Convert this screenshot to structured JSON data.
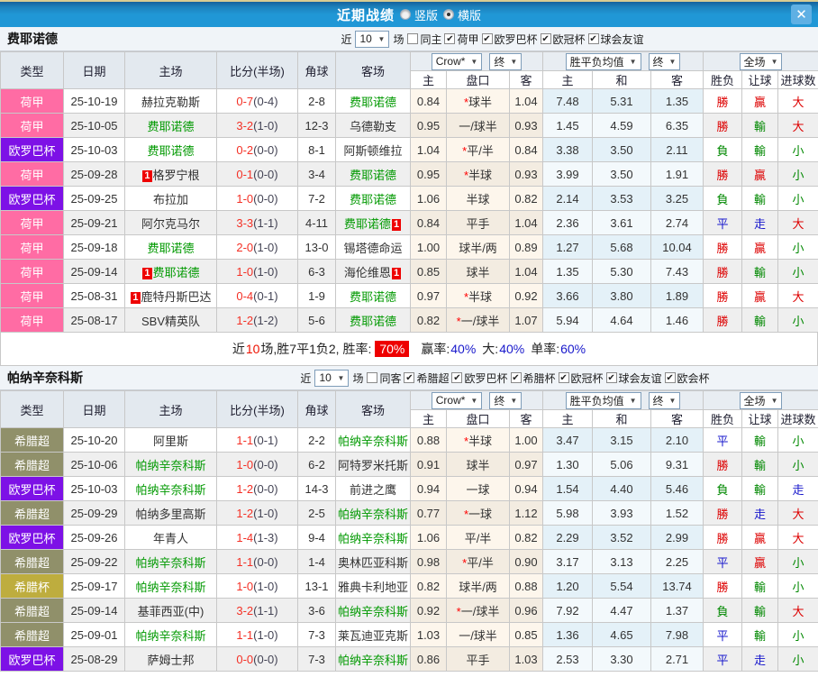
{
  "titlebar": {
    "title": "近期战绩",
    "vertical": "竖版",
    "horizontal": "横版",
    "close": "✕"
  },
  "filter_labels": {
    "near": "近",
    "games": "场"
  },
  "header": {
    "type": "类型",
    "date": "日期",
    "home": "主场",
    "score": "比分(半场)",
    "corner": "角球",
    "away": "客场",
    "odds_source": "Crow*",
    "final": "终",
    "mean": "胜平负均值",
    "final2": "终",
    "scope": "全场",
    "odds_home": "主",
    "handicap": "盘口",
    "odds_away": "客",
    "mean_home": "主",
    "mean_draw": "和",
    "mean_away": "客",
    "result": "胜负",
    "cover": "让球",
    "goals": "进球数"
  },
  "league_colors": {
    "荷甲": "#ff6ca4",
    "欧罗巴杯": "#7d11e6",
    "希腊超": "#90906a",
    "希腊杯": "#bead3e"
  },
  "value_colors": {
    "勝": "#dd0000",
    "負": "#008800",
    "平": "#1818cc",
    "贏": "#dd0000",
    "輸": "#008800",
    "走": "#1818cc",
    "大": "#dd0000",
    "小": "#008800"
  },
  "sections": [
    {
      "team": "费耶诺德",
      "filter": {
        "count": "10",
        "same": "同主",
        "leagues": [
          "荷甲",
          "欧罗巴杯",
          "欧冠杯",
          "球会友谊"
        ]
      },
      "rows": [
        {
          "league": "荷甲",
          "date": "25-10-19",
          "home": {
            "name": "赫拉克勒斯"
          },
          "score": "0-7",
          "half": "(0-4)",
          "corner": "2-8",
          "away": {
            "name": "费耶诺德",
            "green": true
          },
          "odds": [
            "0.84",
            "*球半",
            "1.04"
          ],
          "mean": [
            "7.48",
            "5.31",
            "1.35"
          ],
          "results": [
            "勝",
            "贏",
            "大"
          ]
        },
        {
          "league": "荷甲",
          "date": "25-10-05",
          "home": {
            "name": "费耶诺德",
            "green": true
          },
          "score": "3-2",
          "half": "(1-0)",
          "corner": "12-3",
          "away": {
            "name": "乌德勒支"
          },
          "odds": [
            "0.95",
            "一/球半",
            "0.93"
          ],
          "mean": [
            "1.45",
            "4.59",
            "6.35"
          ],
          "results": [
            "勝",
            "輸",
            "大"
          ]
        },
        {
          "league": "欧罗巴杯",
          "date": "25-10-03",
          "home": {
            "name": "费耶诺德",
            "green": true
          },
          "score": "0-2",
          "half": "(0-0)",
          "corner": "8-1",
          "away": {
            "name": "阿斯顿维拉"
          },
          "odds": [
            "1.04",
            "*平/半",
            "0.84"
          ],
          "mean": [
            "3.38",
            "3.50",
            "2.11"
          ],
          "results": [
            "負",
            "輸",
            "小"
          ]
        },
        {
          "league": "荷甲",
          "date": "25-09-28",
          "home": {
            "name": "格罗宁根",
            "card": "1"
          },
          "score": "0-1",
          "half": "(0-0)",
          "corner": "3-4",
          "away": {
            "name": "费耶诺德",
            "green": true
          },
          "odds": [
            "0.95",
            "*半球",
            "0.93"
          ],
          "mean": [
            "3.99",
            "3.50",
            "1.91"
          ],
          "results": [
            "勝",
            "贏",
            "小"
          ]
        },
        {
          "league": "欧罗巴杯",
          "date": "25-09-25",
          "home": {
            "name": "布拉加"
          },
          "score": "1-0",
          "half": "(0-0)",
          "corner": "7-2",
          "away": {
            "name": "费耶诺德",
            "green": true
          },
          "odds": [
            "1.06",
            "半球",
            "0.82"
          ],
          "mean": [
            "2.14",
            "3.53",
            "3.25"
          ],
          "results": [
            "負",
            "輸",
            "小"
          ]
        },
        {
          "league": "荷甲",
          "date": "25-09-21",
          "home": {
            "name": "阿尔克马尔"
          },
          "score": "3-3",
          "half": "(1-1)",
          "corner": "4-11",
          "away": {
            "name": "费耶诺德",
            "green": true,
            "card": "1"
          },
          "odds": [
            "0.84",
            "平手",
            "1.04"
          ],
          "mean": [
            "2.36",
            "3.61",
            "2.74"
          ],
          "results": [
            "平",
            "走",
            "大"
          ]
        },
        {
          "league": "荷甲",
          "date": "25-09-18",
          "home": {
            "name": "费耶诺德",
            "green": true
          },
          "score": "2-0",
          "half": "(1-0)",
          "corner": "13-0",
          "away": {
            "name": "锡塔德命运"
          },
          "odds": [
            "1.00",
            "球半/两",
            "0.89"
          ],
          "mean": [
            "1.27",
            "5.68",
            "10.04"
          ],
          "results": [
            "勝",
            "贏",
            "小"
          ]
        },
        {
          "league": "荷甲",
          "date": "25-09-14",
          "home": {
            "name": "费耶诺德",
            "green": true,
            "card": "1"
          },
          "score": "1-0",
          "half": "(1-0)",
          "corner": "6-3",
          "away": {
            "name": "海伦维恩",
            "card": "1"
          },
          "odds": [
            "0.85",
            "球半",
            "1.04"
          ],
          "mean": [
            "1.35",
            "5.30",
            "7.43"
          ],
          "results": [
            "勝",
            "輸",
            "小"
          ]
        },
        {
          "league": "荷甲",
          "date": "25-08-31",
          "home": {
            "name": "鹿特丹斯巴达",
            "card": "1"
          },
          "score": "0-4",
          "half": "(0-1)",
          "corner": "1-9",
          "away": {
            "name": "费耶诺德",
            "green": true
          },
          "odds": [
            "0.97",
            "*半球",
            "0.92"
          ],
          "mean": [
            "3.66",
            "3.80",
            "1.89"
          ],
          "results": [
            "勝",
            "贏",
            "大"
          ]
        },
        {
          "league": "荷甲",
          "date": "25-08-17",
          "home": {
            "name": "SBV精英队"
          },
          "score": "1-2",
          "half": "(1-2)",
          "corner": "5-6",
          "away": {
            "name": "费耶诺德",
            "green": true
          },
          "odds": [
            "0.82",
            "*一/球半",
            "1.07"
          ],
          "mean": [
            "5.94",
            "4.64",
            "1.46"
          ],
          "results": [
            "勝",
            "輸",
            "小"
          ]
        }
      ],
      "summary": {
        "part1_pre": "近",
        "part1_num": "10",
        "part1_post": "场,胜7平1负2, 胜率:",
        "rate_badge": "70%",
        "stats": [
          {
            "label": "赢率:",
            "value": "40%"
          },
          {
            "label": "大:",
            "value": "40%"
          },
          {
            "label": "单率:",
            "value": "60%"
          }
        ]
      }
    },
    {
      "team": "帕纳辛奈科斯",
      "filter": {
        "count": "10",
        "same": "同客",
        "leagues": [
          "希腊超",
          "欧罗巴杯",
          "希腊杯",
          "欧冠杯",
          "球会友谊",
          "欧会杯"
        ]
      },
      "rows": [
        {
          "league": "希腊超",
          "date": "25-10-20",
          "home": {
            "name": "阿里斯"
          },
          "score": "1-1",
          "half": "(0-1)",
          "corner": "2-2",
          "away": {
            "name": "帕纳辛奈科斯",
            "green": true
          },
          "odds": [
            "0.88",
            "*半球",
            "1.00"
          ],
          "mean": [
            "3.47",
            "3.15",
            "2.10"
          ],
          "results": [
            "平",
            "輸",
            "小"
          ]
        },
        {
          "league": "希腊超",
          "date": "25-10-06",
          "home": {
            "name": "帕纳辛奈科斯",
            "green": true
          },
          "score": "1-0",
          "half": "(0-0)",
          "corner": "6-2",
          "away": {
            "name": "阿特罗米托斯"
          },
          "odds": [
            "0.91",
            "球半",
            "0.97"
          ],
          "mean": [
            "1.30",
            "5.06",
            "9.31"
          ],
          "results": [
            "勝",
            "輸",
            "小"
          ]
        },
        {
          "league": "欧罗巴杯",
          "date": "25-10-03",
          "home": {
            "name": "帕纳辛奈科斯",
            "green": true
          },
          "score": "1-2",
          "half": "(0-0)",
          "corner": "14-3",
          "away": {
            "name": "前进之鹰"
          },
          "odds": [
            "0.94",
            "一球",
            "0.94"
          ],
          "mean": [
            "1.54",
            "4.40",
            "5.46"
          ],
          "results": [
            "負",
            "輸",
            "走"
          ]
        },
        {
          "league": "希腊超",
          "date": "25-09-29",
          "home": {
            "name": "帕纳多里高斯"
          },
          "score": "1-2",
          "half": "(1-0)",
          "corner": "2-5",
          "away": {
            "name": "帕纳辛奈科斯",
            "green": true
          },
          "odds": [
            "0.77",
            "*一球",
            "1.12"
          ],
          "mean": [
            "5.98",
            "3.93",
            "1.52"
          ],
          "results": [
            "勝",
            "走",
            "大"
          ]
        },
        {
          "league": "欧罗巴杯",
          "date": "25-09-26",
          "home": {
            "name": "年青人"
          },
          "score": "1-4",
          "half": "(1-3)",
          "corner": "9-4",
          "away": {
            "name": "帕纳辛奈科斯",
            "green": true
          },
          "odds": [
            "1.06",
            "平/半",
            "0.82"
          ],
          "mean": [
            "2.29",
            "3.52",
            "2.99"
          ],
          "results": [
            "勝",
            "贏",
            "大"
          ]
        },
        {
          "league": "希腊超",
          "date": "25-09-22",
          "home": {
            "name": "帕纳辛奈科斯",
            "green": true
          },
          "score": "1-1",
          "half": "(0-0)",
          "corner": "1-4",
          "away": {
            "name": "奥林匹亚科斯"
          },
          "odds": [
            "0.98",
            "*平/半",
            "0.90"
          ],
          "mean": [
            "3.17",
            "3.13",
            "2.25"
          ],
          "results": [
            "平",
            "贏",
            "小"
          ]
        },
        {
          "league": "希腊杯",
          "date": "25-09-17",
          "home": {
            "name": "帕纳辛奈科斯",
            "green": true
          },
          "score": "1-0",
          "half": "(1-0)",
          "corner": "13-1",
          "away": {
            "name": "雅典卡利地亚"
          },
          "odds": [
            "0.82",
            "球半/两",
            "0.88"
          ],
          "mean": [
            "1.20",
            "5.54",
            "13.74"
          ],
          "results": [
            "勝",
            "輸",
            "小"
          ]
        },
        {
          "league": "希腊超",
          "date": "25-09-14",
          "home": {
            "name": "基菲西亚(中)"
          },
          "score": "3-2",
          "half": "(1-1)",
          "corner": "3-6",
          "away": {
            "name": "帕纳辛奈科斯",
            "green": true
          },
          "odds": [
            "0.92",
            "*一/球半",
            "0.96"
          ],
          "mean": [
            "7.92",
            "4.47",
            "1.37"
          ],
          "results": [
            "負",
            "輸",
            "大"
          ]
        },
        {
          "league": "希腊超",
          "date": "25-09-01",
          "home": {
            "name": "帕纳辛奈科斯",
            "green": true
          },
          "score": "1-1",
          "half": "(1-0)",
          "corner": "7-3",
          "away": {
            "name": "莱瓦迪亚克斯"
          },
          "odds": [
            "1.03",
            "一/球半",
            "0.85"
          ],
          "mean": [
            "1.36",
            "4.65",
            "7.98"
          ],
          "results": [
            "平",
            "輸",
            "小"
          ]
        },
        {
          "league": "欧罗巴杯",
          "date": "25-08-29",
          "home": {
            "name": "萨姆士邦"
          },
          "score": "0-0",
          "half": "(0-0)",
          "corner": "7-3",
          "away": {
            "name": "帕纳辛奈科斯",
            "green": true
          },
          "odds": [
            "0.86",
            "平手",
            "1.03"
          ],
          "mean": [
            "2.53",
            "3.30",
            "2.71"
          ],
          "results": [
            "平",
            "走",
            "小"
          ]
        }
      ]
    }
  ]
}
